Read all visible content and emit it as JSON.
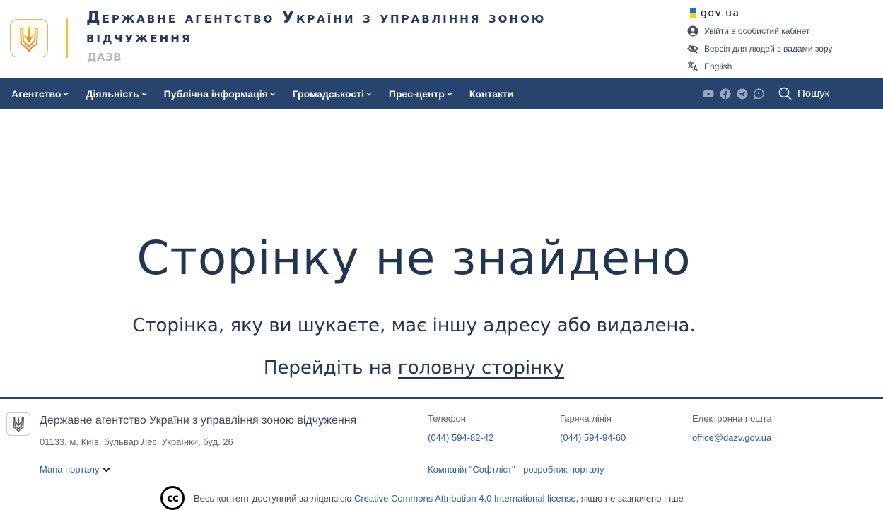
{
  "header": {
    "title": "Державне агентство України з управління зоною відчуження",
    "abbr": "ДАЗВ"
  },
  "utility": {
    "govua": "gov.ua",
    "login": "Увійти в особистий кабінет",
    "accessibility": "Версія для людей з вадами зору",
    "language": "English"
  },
  "nav": {
    "items": [
      {
        "label": "Агентство",
        "dropdown": true
      },
      {
        "label": "Діяльність",
        "dropdown": true
      },
      {
        "label": "Публічна інформація",
        "dropdown": true
      },
      {
        "label": "Громадськості",
        "dropdown": true
      },
      {
        "label": "Прес-центр",
        "dropdown": true
      },
      {
        "label": "Контакти",
        "dropdown": false
      }
    ],
    "social": [
      "youtube-icon",
      "facebook-icon",
      "telegram-icon",
      "whatsapp-icon"
    ],
    "search_label": "Пошук"
  },
  "main": {
    "heading": "Сторінку не знайдено",
    "subtitle": "Сторінка, яку ви шукаєте, має іншу адресу або видалена.",
    "goto_prefix": "Перейдіть на",
    "goto_link": "головну сторінку"
  },
  "footer": {
    "org_name": "Державне агентство України з управління зоною відчуження",
    "address": "01133, м. Київ, бульвар Лесі Українки, буд. 26",
    "sitemap": "Мапа порталу",
    "phone_label": "Телефон",
    "phone": "(044) 594-82-42",
    "hotline_label": "Гаряча лінія",
    "hotline": "(044) 594-94-60",
    "email_label": "Електронна пошта",
    "email": "office@dazv.gov.ua",
    "developer": "Компанія \"Софтліст\" - розробник порталу",
    "license_prefix": "Весь контент доступний за ліцензією",
    "license_link": "Creative Commons Attribution 4.0 International license",
    "license_suffix": ", якщо не зазначено інше",
    "cc_badge": "cc"
  },
  "colors": {
    "nav_bg": "#27446e",
    "title": "#223551",
    "link": "#2d5fa0",
    "accent_yellow": "#f2c230"
  }
}
